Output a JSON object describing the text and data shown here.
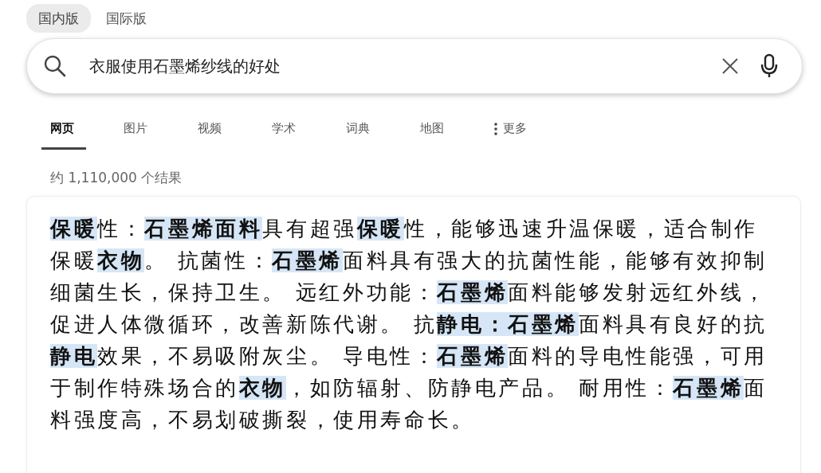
{
  "version_tabs": [
    {
      "label": "国内版",
      "selected": true
    },
    {
      "label": "国际版",
      "selected": false
    }
  ],
  "search": {
    "value": "衣服使用石墨烯纱线的好处"
  },
  "nav_tabs": [
    {
      "label": "网页",
      "selected": true,
      "kind": "tab"
    },
    {
      "label": "图片",
      "selected": false,
      "kind": "tab"
    },
    {
      "label": "视频",
      "selected": false,
      "kind": "tab"
    },
    {
      "label": "学术",
      "selected": false,
      "kind": "tab"
    },
    {
      "label": "词典",
      "selected": false,
      "kind": "tab"
    },
    {
      "label": "地图",
      "selected": false,
      "kind": "tab"
    },
    {
      "label": "更多",
      "selected": false,
      "kind": "more"
    }
  ],
  "result_count": "约 1,110,000 个结果",
  "answer": {
    "text": "**保暖**性：**石墨烯面料**具有超强**保暖**性，能够迅速升温保暖，适合制作保暖**衣物**。 抗菌性：**石墨烯**面料具有强大的抗菌性能，能够有效抑制细菌生长，保持卫生。 远红外功能：**石墨烯**面料能够发射远红外线，促进人体微循环，改善新陈代谢。 抗**静电：石墨烯**面料具有良好的抗**静电**效果，不易吸附灰尘。 导电性：**石墨烯**面料的导电性能强，可用于制作特殊场合的**衣物**，如防辐射、防静电产品。 耐用性：**石墨烯**面料强度高，不易划破撕裂，使用寿命长。"
  }
}
